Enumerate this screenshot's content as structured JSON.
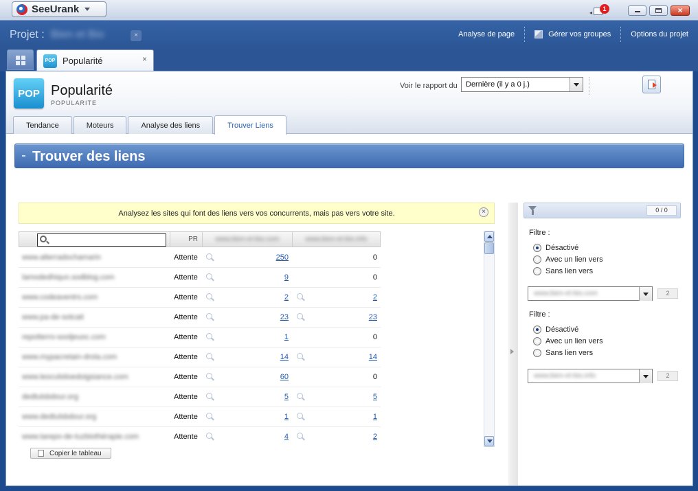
{
  "titlebar": {
    "app_name": "SeeUrank",
    "notification_count": "1"
  },
  "project": {
    "label": "Projet :",
    "name": "Bien et Bio",
    "close_glyph": "×",
    "links": [
      "Analyse de page",
      "Gérer vos groupes",
      "Options du projet"
    ]
  },
  "tabs": {
    "document_tab": {
      "icon_text": "POP",
      "label": "Popularité",
      "close_glyph": "×"
    }
  },
  "header": {
    "icon_text": "POP",
    "title": "Popularité",
    "subtitle": "POPULARITE",
    "report_label": "Voir le rapport du",
    "report_value": "Dernière (il y a 0 j.)"
  },
  "subtabs": [
    "Tendance",
    "Moteurs",
    "Analyse des liens",
    "Trouver Liens"
  ],
  "section": {
    "title": "Trouver des liens"
  },
  "info": {
    "message": "Analysez les sites qui font des liens vers vos concurrents, mais pas vers votre site.",
    "close_glyph": "×"
  },
  "table": {
    "search_placeholder": "",
    "columns": {
      "pr": "PR",
      "competitor1": "www.bien-et-bio.com",
      "competitor2": "www.bien-et-bio.info"
    },
    "rows": [
      {
        "site": "www.alterradochamarin",
        "pr": "Attente",
        "c1": "250",
        "c2": "0",
        "c2_link": false
      },
      {
        "site": "lamodedhiqun.sodblog.com",
        "pr": "Attente",
        "c1": "9",
        "c2": "0",
        "c2_link": false
      },
      {
        "site": "www.codeaventrs.com",
        "pr": "Attente",
        "c1": "2",
        "c2": "2",
        "c2_link": true
      },
      {
        "site": "www.pa-de-sotcati",
        "pr": "Attente",
        "c1": "23",
        "c2": "23",
        "c2_link": true
      },
      {
        "site": "repotterro-sooljeuoc.com",
        "pr": "Attente",
        "c1": "1",
        "c2": "0",
        "c2_link": false
      },
      {
        "site": "www.mypacretain-drola.com",
        "pr": "Attente",
        "c1": "14",
        "c2": "14",
        "c2_link": true
      },
      {
        "site": "www.leoculstioedoigsiance.com",
        "pr": "Attente",
        "c1": "60",
        "c2": "0",
        "c2_link": false
      },
      {
        "site": "dedtulsbdour.org",
        "pr": "Attente",
        "c1": "5",
        "c2": "5",
        "c2_link": true
      },
      {
        "site": "www.dedtulsbdour.org",
        "pr": "Attente",
        "c1": "1",
        "c2": "1",
        "c2_link": true
      },
      {
        "site": "www.tarepo-de-tuzbiothérapie.com",
        "pr": "Attente",
        "c1": "4",
        "c2": "2",
        "c2_link": true
      }
    ],
    "copy_label": "Copier le tableau"
  },
  "panel": {
    "count": "0 / 0",
    "filters": [
      {
        "label": "Filtre :",
        "options": [
          "Désactivé",
          "Avec un lien vers",
          "Sans lien vers"
        ],
        "selected": 0,
        "site": "www.bien-et-bio.com",
        "count": "2"
      },
      {
        "label": "Filtre :",
        "options": [
          "Désactivé",
          "Avec un lien vers",
          "Sans lien vers"
        ],
        "selected": 0,
        "site": "www.bien-et-bio.info",
        "count": "2"
      }
    ]
  },
  "icons": {
    "app_logo": "seeurank-logo-icon",
    "notification": "notification-book-icon",
    "grid": "grid-icon",
    "export": "export-icon",
    "search": "search-icon",
    "zoom": "zoom-icon",
    "filter": "funnel-icon"
  },
  "colors": {
    "accent": "#2b5595",
    "link": "#2058b0",
    "info_bg": "#ffffcc",
    "section_bar": "#4a77b8"
  }
}
